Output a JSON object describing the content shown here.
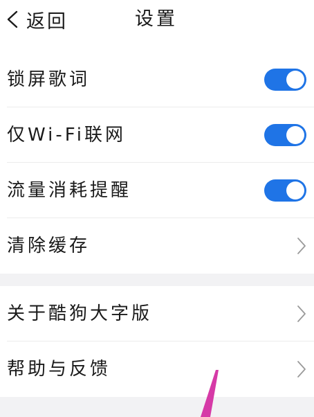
{
  "header": {
    "back_label": "返回",
    "title": "设置"
  },
  "settings": {
    "lock_screen_lyrics": {
      "label": "锁屏歌词",
      "enabled": true
    },
    "wifi_only": {
      "label": "仅Wi-Fi联网",
      "enabled": true
    },
    "data_usage_reminder": {
      "label": "流量消耗提醒",
      "enabled": true
    },
    "clear_cache": {
      "label": "清除缓存"
    }
  },
  "about": {
    "about_app": {
      "label": "关于酷狗大字版"
    },
    "help_feedback": {
      "label": "帮助与反馈"
    }
  },
  "colors": {
    "toggle_on": "#1f74e6",
    "annotation_arrow": "#d63aa7"
  },
  "icons": [
    "back-chevron-icon",
    "chevron-right-icon",
    "annotation-arrow"
  ]
}
